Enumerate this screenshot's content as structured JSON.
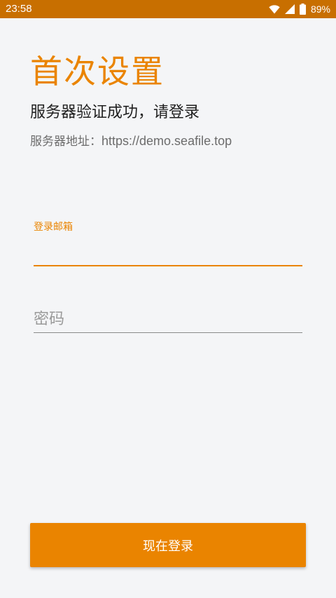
{
  "status_bar": {
    "time": "23:58",
    "battery": "89%",
    "icons": [
      "wifi-icon",
      "signal-icon",
      "battery-icon"
    ]
  },
  "page": {
    "title": "首次设置",
    "subtitle": "服务器验证成功，请登录",
    "server_label": "服务器地址：",
    "server_url": "https://demo.seafile.top"
  },
  "form": {
    "email_label": "登录邮箱",
    "email_value": "",
    "password_placeholder": "密码",
    "password_value": ""
  },
  "actions": {
    "login_label": "现在登录"
  },
  "colors": {
    "accent": "#ea8400",
    "status_bar": "#c86f00",
    "background": "#f4f5f7"
  }
}
